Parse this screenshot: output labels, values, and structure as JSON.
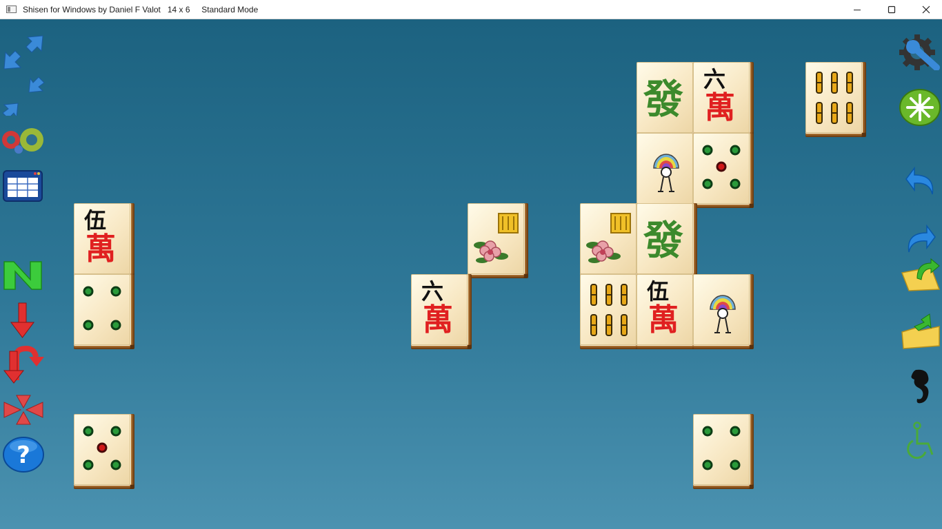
{
  "window": {
    "title": "Shisen for Windows by Daniel F Valot   14 x 6     Standard Mode",
    "controls": [
      "minimize-icon",
      "maximize-icon",
      "close-icon"
    ]
  },
  "left_toolbar": [
    "zoom-in-icon",
    "zoom-out-icon",
    "colors-icon",
    "scores-table-icon",
    "new-game-icon",
    "hint-down-icon",
    "hint-turn-icon",
    "shuffle-icon",
    "help-icon"
  ],
  "right_toolbar": [
    "settings-icon",
    "restart-icon",
    "undo-icon",
    "redo-icon",
    "open-game-icon",
    "save-game-icon",
    "seahorse-icon",
    "accessibility-icon"
  ],
  "glyphs": {
    "five": "伍",
    "six": "六",
    "wan": "萬",
    "fa": "發"
  },
  "colors": {
    "background": "#1e6682",
    "wan_red": "#e02020",
    "fa_green": "#3c8a2c",
    "dot_green": "#2a9a3a",
    "dot_red": "#d01818",
    "bamboo_gold": "#e8a818"
  },
  "tiles": [
    {
      "suit": "character",
      "rank": 5
    },
    {
      "suit": "dots",
      "rank": 4
    },
    {
      "suit": "dots",
      "rank": 5
    },
    {
      "suit": "season",
      "rank": "chrysanthemum"
    },
    {
      "suit": "character",
      "rank": 6
    },
    {
      "suit": "dragon",
      "rank": "green"
    },
    {
      "suit": "character",
      "rank": 6
    },
    {
      "suit": "flower",
      "rank": "fan"
    },
    {
      "suit": "dots",
      "rank": 5
    },
    {
      "suit": "season",
      "rank": "chrysanthemum"
    },
    {
      "suit": "dragon",
      "rank": "green"
    },
    {
      "suit": "bamboo",
      "rank": 6
    },
    {
      "suit": "character",
      "rank": 5
    },
    {
      "suit": "flower",
      "rank": "fan"
    },
    {
      "suit": "bamboo",
      "rank": 6
    },
    {
      "suit": "dots",
      "rank": 4
    }
  ]
}
